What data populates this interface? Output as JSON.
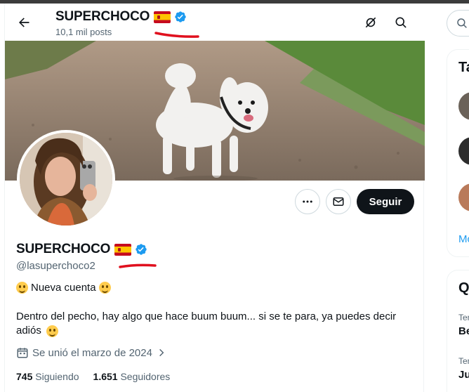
{
  "header": {
    "title": "SUPERCHOCO",
    "post_count": "10,1 mil posts"
  },
  "profile": {
    "name": "SUPERCHOCO",
    "handle": "@lasuperchoco2",
    "tagline": "Nueva cuenta",
    "bio": "Dentro del pecho, hay algo que hace buum buum... si se te para, ya puedes decir adiós",
    "joined": "Se unió el marzo de 2024",
    "following_count": "745",
    "following_label": "Siguiendo",
    "followers_count": "1.651",
    "followers_label": "Seguidores"
  },
  "actions": {
    "follow_label": "Seguir"
  },
  "sidebar": {
    "card1_title": "Ta",
    "card1_more": "Mc",
    "card2_title": "Q",
    "card2_item1_small": "Ten",
    "card2_item1_bold": "Be",
    "card2_item2_small": "Ten",
    "card2_item2_bold": "Ju"
  },
  "colors": {
    "accent": "#1d9bf0",
    "annotation": "#e0101e",
    "follow_button": "#0f1419"
  },
  "icons": [
    "back-arrow-icon",
    "spaces-icon",
    "search-icon",
    "more-icon",
    "mail-icon",
    "calendar-icon",
    "verified-icon",
    "spain-flag-icon",
    "smile-emoji-icon"
  ]
}
